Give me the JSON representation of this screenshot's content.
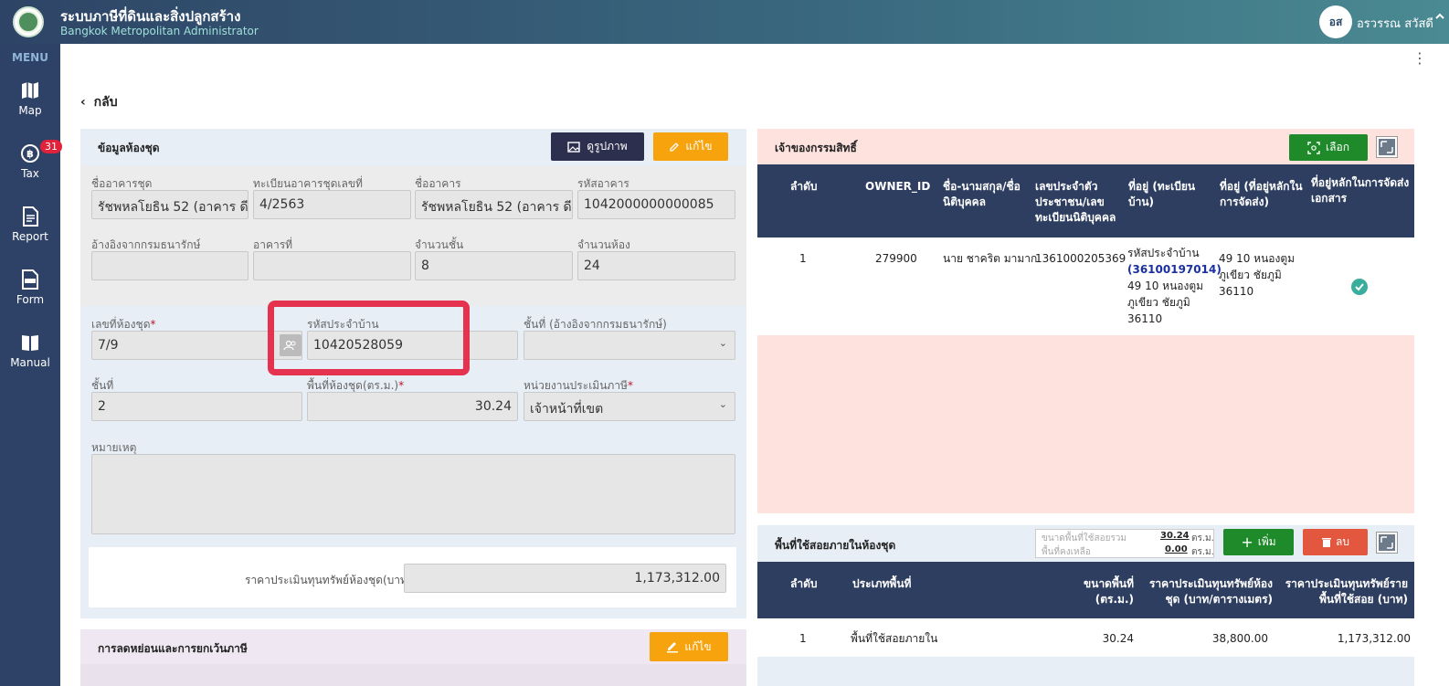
{
  "header": {
    "app_title": "ระบบภาษีที่ดินและสิ่งปลูกสร้าง",
    "app_subtitle": "Bangkok Metropolitan Administrator",
    "user_initials": "อส",
    "user_name": "อรวรรณ สวัสดี"
  },
  "sidebar": {
    "menu_label": "MENU",
    "items": [
      {
        "label": "Map",
        "icon": "map-icon"
      },
      {
        "label": "Tax",
        "icon": "tax-icon",
        "badge": "31"
      },
      {
        "label": "Report",
        "icon": "report-icon"
      },
      {
        "label": "Form",
        "icon": "form-icon"
      },
      {
        "label": "Manual",
        "icon": "manual-icon"
      }
    ]
  },
  "back_label": "กลับ",
  "unit_panel": {
    "title": "ข้อมูลห้องชุด",
    "view_image_label": "ดูรูปภาพ",
    "edit_label": "แก้ไข",
    "fields": {
      "building_name_label": "ชื่ออาคารชุด",
      "building_name": "รัชพหลโยธิน 52 (อาคาร ดี)",
      "registry_no_label": "ทะเบียนอาคารชุดเลขที่",
      "registry_no": "4/2563",
      "building_label": "ชื่ออาคาร",
      "building": "รัชพหลโยธิน 52 (อาคาร ดี)",
      "building_code_label": "รหัสอาคาร",
      "building_code": "1042000000000085",
      "treasury_ref_label": "อ้างอิงจากกรมธนารักษ์",
      "treasury_ref": "",
      "building_no_label": "อาคารที่",
      "building_no": "",
      "floors_label": "จำนวนชั้น",
      "floors": "8",
      "rooms_label": "จำนวนห้อง",
      "rooms": "24",
      "unit_no_label": "เลขที่ห้องชุด",
      "unit_no": "7/9",
      "house_code_label": "รหัสประจำบ้าน",
      "house_code": "10420528059",
      "floor_treasury_label": "ชั้นที่ (อ้างอิงจากกรมธนารักษ์)",
      "floor_treasury": "",
      "floor_label": "ชั้นที่",
      "floor": "2",
      "area_label": "พื้นที่ห้องชุด(ตร.ม.)",
      "area": "30.24",
      "tax_unit_label": "หน่วยงานประเมินภาษี",
      "tax_unit": "เจ้าหน้าที่เขต",
      "remark_label": "หมายเหตุ",
      "remark": "",
      "price_label": "ราคาประเมินทุนทรัพย์ห้องชุด(บาท)",
      "price": "1,173,312.00"
    }
  },
  "reduction_panel": {
    "title": "การลดหย่อนและการยกเว้นภาษี",
    "edit_label": "แก้ไข"
  },
  "owner_panel": {
    "title": "เจ้าของกรรมสิทธิ์",
    "select_label": "เลือก",
    "columns": [
      "ลำดับ",
      "OWNER_ID",
      "ชื่อ-นามสกุล/ชื่อนิติบุคคล",
      "เลขประจำตัวประชาชน/เลขทะเบียนนิติบุคคล",
      "ที่อยู่ (ทะเบียนบ้าน)",
      "ที่อยู่ (ที่อยู่หลักในการจัดส่ง)",
      "ที่อยู่หลักในการจัดส่งเอกสาร"
    ],
    "rows": [
      {
        "no": "1",
        "owner_id": "279900",
        "name": "นาย ชาคริต มามาก",
        "id_no": "1361000205369",
        "addr_prefix": "รหัสประจำบ้าน",
        "addr_code": "(36100197014)",
        "addr_rest": "49 10 หนองตูม ภูเขียว ชัยภูมิ 36110",
        "mail_addr": "49 10 หนองตูม ภูเขียว ชัยภูมิ 36110"
      }
    ]
  },
  "usage_panel": {
    "title": "พื้นที่ใช้สอยภายในห้องชุด",
    "total_area_label": "ขนาดพื้นที่ใช้สอยรวม",
    "total_area": "30.24",
    "remaining_label": "พื้นที่คงเหลือ",
    "remaining": "0.00",
    "unit": "ตร.ม.",
    "add_label": "เพิ่ม",
    "delete_label": "ลบ",
    "columns": [
      "ลำดับ",
      "ประเภทพื้นที่",
      "ขนาดพื้นที่ (ตร.ม.)",
      "ราคาประเมินทุนทรัพย์ห้องชุด (บาท/ตารางเมตร)",
      "ราคาประเมินทุนทรัพย์ราย พื้นที่ใช้สอย (บาท)"
    ],
    "rows": [
      {
        "no": "1",
        "type": "พื้นที่ใช้สอยภายใน",
        "size": "30.24",
        "price_per_sqm": "38,800.00",
        "price": "1,173,312.00"
      }
    ]
  },
  "colors": {
    "sidebar": "#2e4166",
    "table_header": "#2e3e60",
    "orange": "#f7a30e",
    "green": "#1f8a2a",
    "red": "#e3573e",
    "highlight": "#e5334f"
  }
}
